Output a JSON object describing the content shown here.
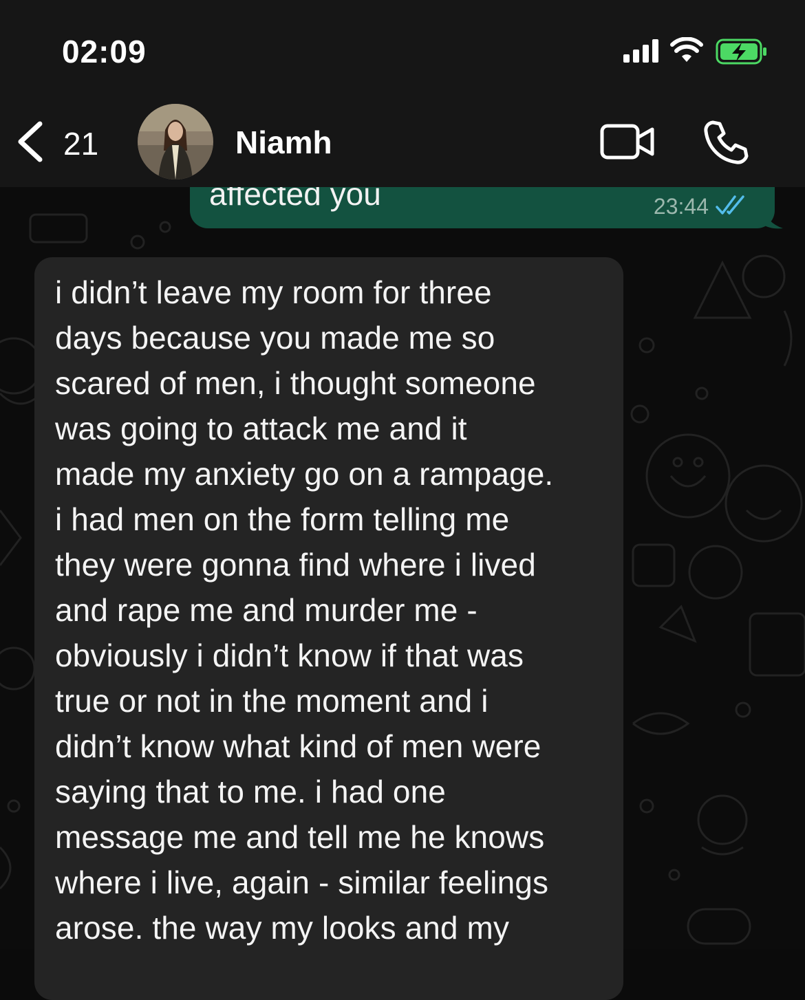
{
  "status_bar": {
    "time": "02:09",
    "icons": [
      "signal-icon",
      "wifi-icon",
      "battery-charging-icon"
    ]
  },
  "header": {
    "back_count": "21",
    "contact_name": "Niamh",
    "icons": [
      "chevron-left-icon",
      "avatar",
      "video-camera-icon",
      "phone-icon"
    ]
  },
  "messages": {
    "outgoing": {
      "text": "affected you",
      "time": "23:44",
      "status_icon": "double-check-icon"
    },
    "incoming": {
      "text": "i didn’t leave my room for three\ndays because you made me so\nscared of men, i thought someone\nwas going to attack me and it\nmade my anxiety go on a rampage.\ni had men on the form telling me\nthey were gonna find where i lived\nand rape me and murder me -\nobviously i didn’t know if that was\ntrue or not in the moment and i\ndidn’t know what kind of men were\nsaying that to me. i had one\nmessage me and tell me he knows\nwhere i live, again - similar feelings\narose. the way my looks and my"
    }
  },
  "colors": {
    "outgoing_bubble": "#135240",
    "incoming_bubble": "#242424",
    "header_bg": "#161616",
    "read_tick": "#53bdeb",
    "battery": "#4cd964"
  }
}
